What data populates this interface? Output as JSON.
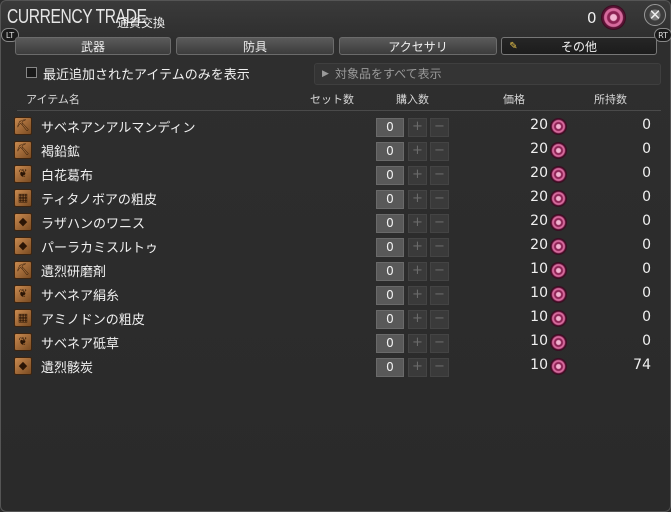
{
  "title": {
    "main": "CURRENCY TRADE",
    "sub": "通貨交換",
    "currency_count": "0",
    "close_icon": "✕"
  },
  "buttons": {
    "lt": "LT",
    "rt": "RT"
  },
  "tabs": [
    {
      "label": "武器"
    },
    {
      "label": "防具"
    },
    {
      "label": "アクセサリ"
    },
    {
      "label": "その他"
    }
  ],
  "filter": {
    "checkbox_label": "最近追加されたアイテムのみを表示",
    "dropdown_label": "対象品をすべて表示"
  },
  "columns": {
    "item_name": "アイテム名",
    "set_count": "セット数",
    "purchase_count": "購入数",
    "price": "価格",
    "owned": "所持数"
  },
  "rows": [
    {
      "name": "サベネアンアルマンディン",
      "qty": "0",
      "price": "20",
      "owned": "0",
      "icon": "pickaxe-icon"
    },
    {
      "name": "褐鉛鉱",
      "qty": "0",
      "price": "20",
      "owned": "0",
      "icon": "pickaxe-icon"
    },
    {
      "name": "白花葛布",
      "qty": "0",
      "price": "20",
      "owned": "0",
      "icon": "leaf-icon"
    },
    {
      "name": "ティタノボアの粗皮",
      "qty": "0",
      "price": "20",
      "owned": "0",
      "icon": "hide-icon"
    },
    {
      "name": "ラザハンのワニス",
      "qty": "0",
      "price": "20",
      "owned": "0",
      "icon": "flask-icon"
    },
    {
      "name": "パーラカミスルトゥ",
      "qty": "0",
      "price": "20",
      "owned": "0",
      "icon": "flask-icon"
    },
    {
      "name": "遺烈研磨剤",
      "qty": "0",
      "price": "10",
      "owned": "0",
      "icon": "pickaxe-icon"
    },
    {
      "name": "サベネア絹糸",
      "qty": "0",
      "price": "10",
      "owned": "0",
      "icon": "leaf-icon"
    },
    {
      "name": "アミノドンの粗皮",
      "qty": "0",
      "price": "10",
      "owned": "0",
      "icon": "hide-icon"
    },
    {
      "name": "サベネア砥草",
      "qty": "0",
      "price": "10",
      "owned": "0",
      "icon": "leaf-icon"
    },
    {
      "name": "遺烈骸炭",
      "qty": "0",
      "price": "10",
      "owned": "74",
      "icon": "flask-icon"
    }
  ],
  "colors": {
    "background": "#2b2b2b",
    "currency_coin": "#d66a9d",
    "tab_icon": "#e9c44b"
  }
}
